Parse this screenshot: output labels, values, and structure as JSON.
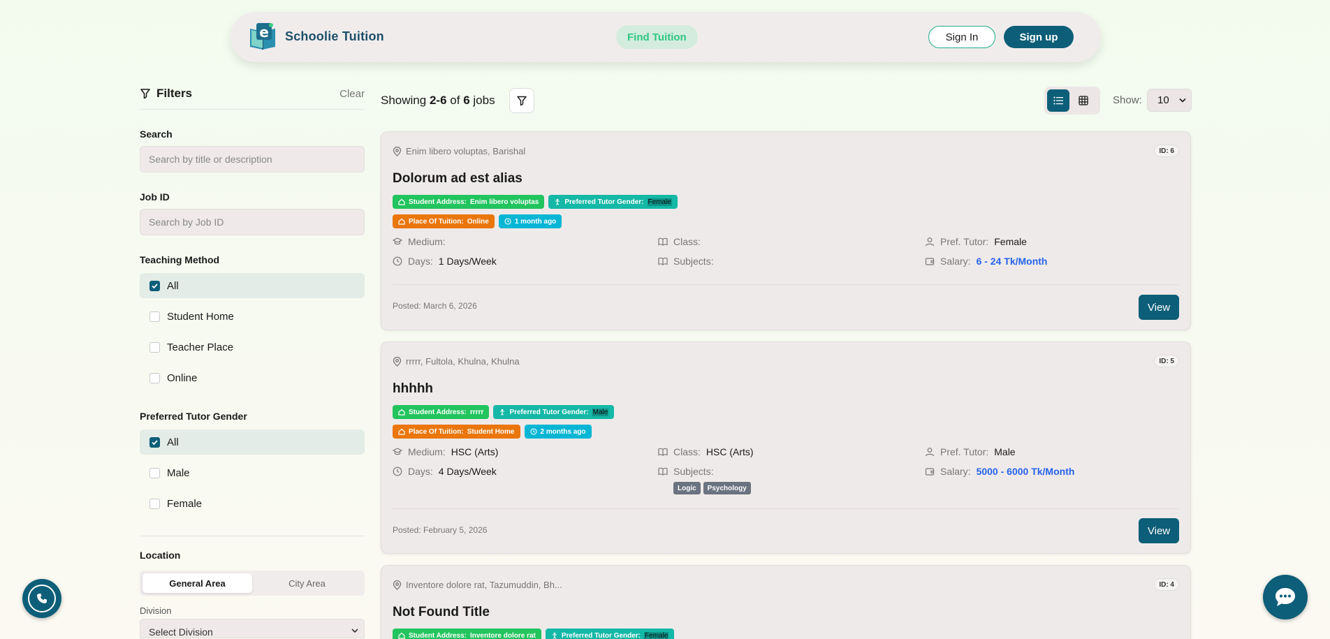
{
  "header": {
    "brand": "Schoolie Tuition",
    "nav_find_tuition": "Find Tuition",
    "sign_in": "Sign In",
    "sign_up": "Sign up"
  },
  "sidebar": {
    "title": "Filters",
    "clear": "Clear",
    "search_label": "Search",
    "search_placeholder": "Search by title or description",
    "jobid_label": "Job ID",
    "jobid_placeholder": "Search by Job ID",
    "teaching_label": "Teaching Method",
    "teaching_options": [
      {
        "label": "All",
        "checked": true
      },
      {
        "label": "Student Home",
        "checked": false
      },
      {
        "label": "Teacher Place",
        "checked": false
      },
      {
        "label": "Online",
        "checked": false
      }
    ],
    "gender_label": "Preferred Tutor Gender",
    "gender_options": [
      {
        "label": "All",
        "checked": true
      },
      {
        "label": "Male",
        "checked": false
      },
      {
        "label": "Female",
        "checked": false
      }
    ],
    "location_label": "Location",
    "location_tabs": [
      "General Area",
      "City Area"
    ],
    "division_label": "Division",
    "division_select": "Select Division"
  },
  "results": {
    "showing_prefix": "Showing",
    "range": "2-6",
    "of_word": "of",
    "total": "6",
    "jobs_word": "jobs",
    "show_label": "Show:",
    "show_value": "10"
  },
  "labels": {
    "medium": "Medium:",
    "class": "Class:",
    "pref_tutor": "Pref. Tutor:",
    "days": "Days:",
    "subjects": "Subjects:",
    "salary": "Salary:",
    "view": "View",
    "student_address": "Student Address:",
    "preferred_gender": "Preferred Tutor Gender:",
    "place_of_tuition": "Place Of Tuition:"
  },
  "jobs": [
    {
      "location": "Enim libero voluptas, Barishal",
      "id": "ID: 6",
      "title": "Dolorum ad est alias",
      "address": "Enim libero voluptas",
      "gender": "Female",
      "place": "Online",
      "ago": "1 month ago",
      "medium": "",
      "class": "",
      "pref_tutor": "Female",
      "days": "1 Days/Week",
      "salary": "6 - 24 Tk/Month",
      "posted": "Posted: March 6, 2026"
    },
    {
      "location": "rrrrr, Fultola, Khulna, Khulna",
      "id": "ID: 5",
      "title": "hhhhh",
      "address": "rrrrr",
      "gender": "Male",
      "place": "Student Home",
      "ago": "2 months ago",
      "medium": "HSC (Arts)",
      "class": "HSC (Arts)",
      "pref_tutor": "Male",
      "days": "4 Days/Week",
      "salary": "5000 - 6000 Tk/Month",
      "subject_tags": [
        "Logic",
        "Psychology"
      ],
      "posted": "Posted: February 5, 2026"
    },
    {
      "location": "Inventore dolore rat, Tazumuddin, Bh...",
      "id": "ID: 4",
      "title": "Not Found Title",
      "address": "Inventore dolore rat",
      "gender": "Female"
    }
  ],
  "colors": {
    "primary": "#0d5e78",
    "accent_green": "#22c45e",
    "accent_teal": "#14b8a6",
    "accent_orange": "#ea760c",
    "accent_sky": "#06b6d4",
    "salary_blue": "#2563eb"
  }
}
